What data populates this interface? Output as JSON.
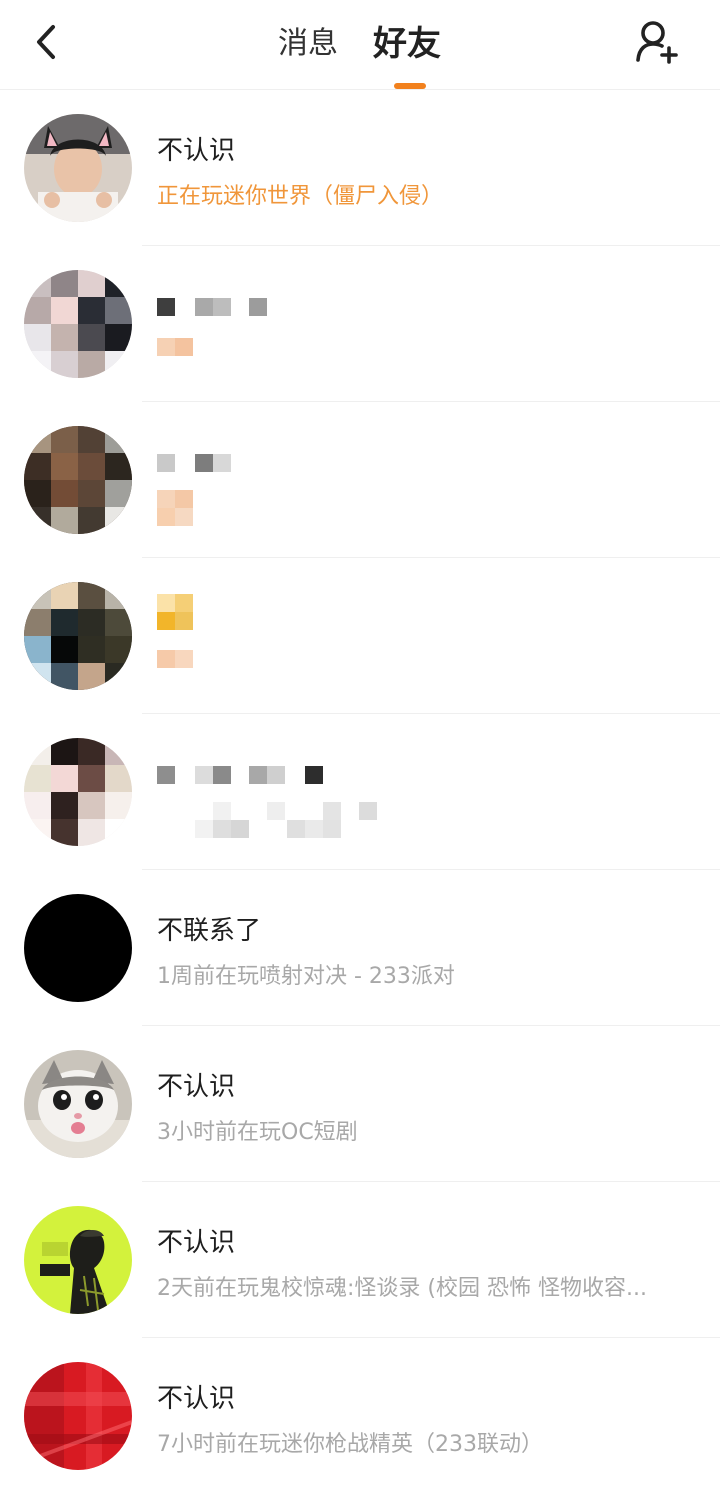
{
  "header": {
    "tabs": [
      {
        "label": "消息",
        "active": false
      },
      {
        "label": "好友",
        "active": true
      }
    ],
    "accent_color": "#f2811d",
    "icons": {
      "back": "chevron-left-icon",
      "add_friend": "add-friend-icon"
    }
  },
  "friends": [
    {
      "name": "不认识",
      "status": "正在玩迷你世界（僵尸入侵）",
      "status_color": "#f0963a",
      "avatar": "photo-boy-cat-ears"
    },
    {
      "name": "",
      "status": "",
      "avatar": "pixelated"
    },
    {
      "name": "",
      "status": "",
      "avatar": "pixelated"
    },
    {
      "name": "",
      "status": "",
      "avatar": "pixelated"
    },
    {
      "name": "",
      "status": "",
      "avatar": "pixelated"
    },
    {
      "name": "不联系了",
      "status": "1周前在玩喷射对决 - 233派对",
      "avatar": "solid-black"
    },
    {
      "name": "不认识",
      "status": "3小时前在玩OC短剧",
      "avatar": "photo-cat"
    },
    {
      "name": "不认识",
      "status": "2天前在玩鬼校惊魂:怪谈录 (校园 恐怖 怪物收容...",
      "avatar": "photo-hugo-poster"
    },
    {
      "name": "不认识",
      "status": "7小时前在玩迷你枪战精英（233联动）",
      "avatar": "photo-red-plaid"
    }
  ]
}
